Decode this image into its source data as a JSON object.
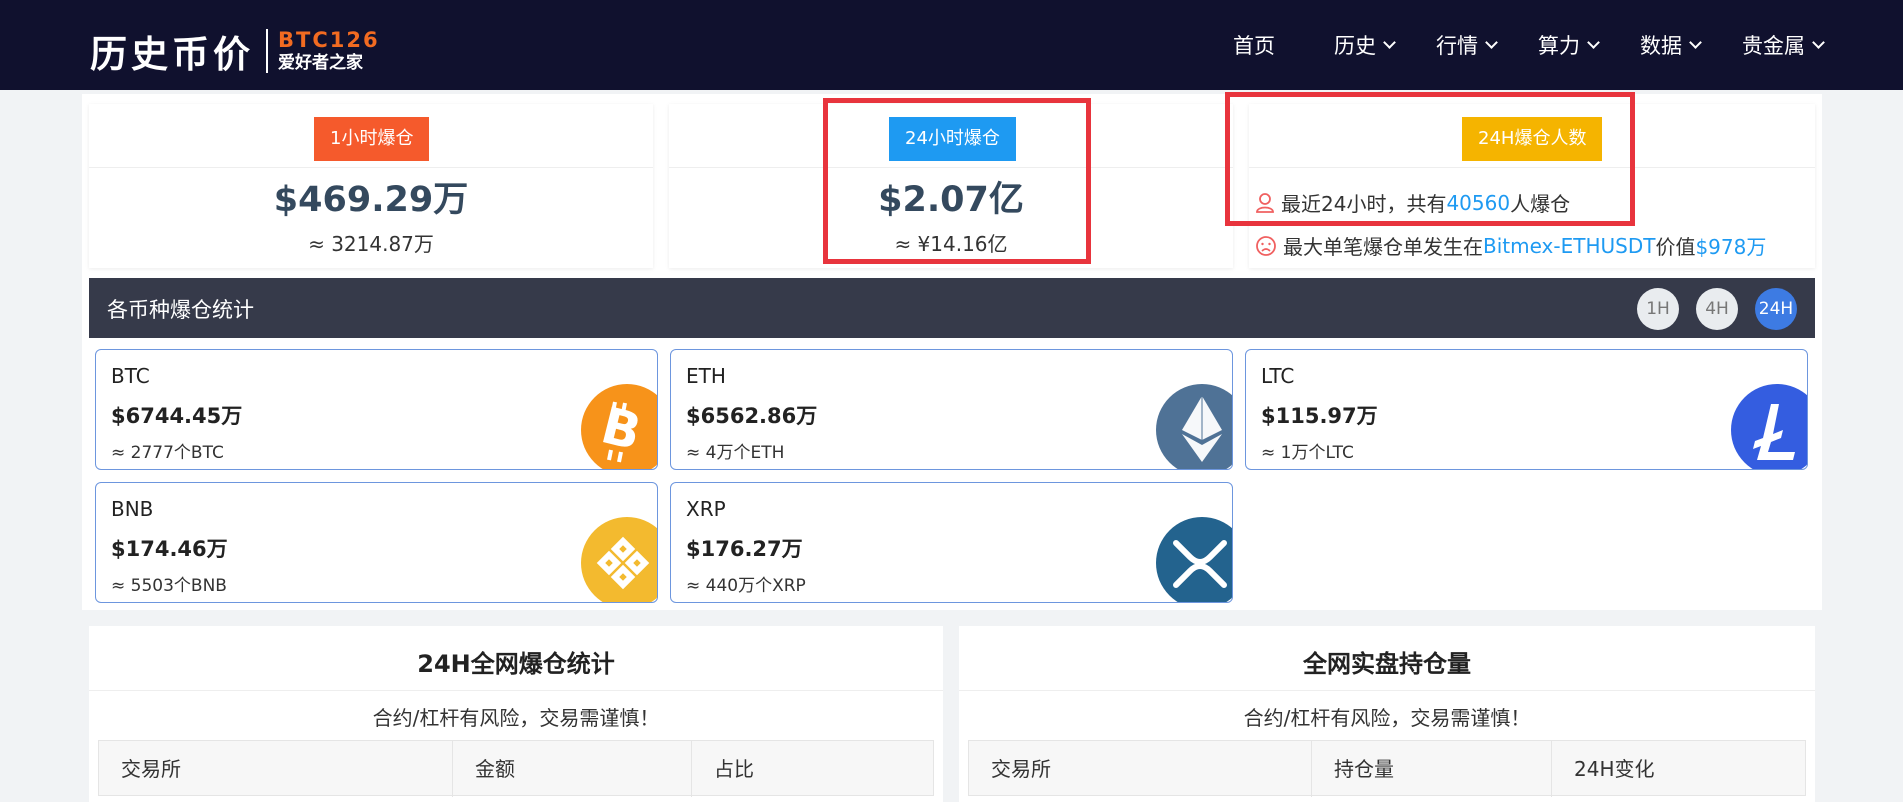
{
  "header": {
    "logo_cn": "历史币价",
    "logo_en": "BTC126",
    "logo_sub": "爱好者之家",
    "nav": [
      {
        "label": "首页",
        "dropdown": false
      },
      {
        "label": "历史",
        "dropdown": true
      },
      {
        "label": "行情",
        "dropdown": true
      },
      {
        "label": "算力",
        "dropdown": true
      },
      {
        "label": "数据",
        "dropdown": true
      },
      {
        "label": "贵金属",
        "dropdown": true
      }
    ]
  },
  "summary": {
    "h1": {
      "badge": "1小时爆仓",
      "usd": "$469.29万",
      "approx": "≈ 3214.87万",
      "color": "#f55a2c"
    },
    "h24": {
      "badge": "24小时爆仓",
      "usd": "$2.07亿",
      "approx": "≈ ¥14.16亿",
      "color": "#1e9af2"
    },
    "people": {
      "badge": "24H爆仓人数",
      "color": "#f5b400",
      "line1_prefix": "最近24小时，共有",
      "line1_count": "40560",
      "line1_suffix": "人爆仓",
      "line2_prefix": "最大单笔爆仓单发生在",
      "line2_exchange": "Bitmex-ETHUSDT",
      "line2_mid": "价值",
      "line2_value": "$978万"
    }
  },
  "coin_stats": {
    "title": "各币种爆仓统计",
    "time_buttons": [
      {
        "label": "1H",
        "active": false
      },
      {
        "label": "4H",
        "active": false
      },
      {
        "label": "24H",
        "active": true
      }
    ],
    "coins": [
      {
        "name": "BTC",
        "value": "$6744.45万",
        "qty": "≈ 2777个BTC",
        "color": "#f7931a",
        "icon": "bitcoin-icon"
      },
      {
        "name": "ETH",
        "value": "$6562.86万",
        "qty": "≈ 4万个ETH",
        "color": "#4f7296",
        "icon": "ethereum-icon"
      },
      {
        "name": "LTC",
        "value": "$115.97万",
        "qty": "≈ 1万个LTC",
        "color": "#345de0",
        "icon": "litecoin-icon"
      },
      {
        "name": "BNB",
        "value": "$174.46万",
        "qty": "≈ 5503个BNB",
        "color": "#f3ba2f",
        "icon": "bnb-icon"
      },
      {
        "name": "XRP",
        "value": "$176.27万",
        "qty": "≈ 440万个XRP",
        "color": "#23638e",
        "icon": "xrp-icon"
      }
    ]
  },
  "panels": {
    "left": {
      "title": "24H全网爆仓统计",
      "note": "合约/杠杆有风险，交易需谨慎！",
      "columns": [
        "交易所",
        "金额",
        "占比"
      ]
    },
    "right": {
      "title": "全网实盘持仓量",
      "note": "合约/杠杆有风险，交易需谨慎！",
      "columns": [
        "交易所",
        "持仓量",
        "24H变化"
      ]
    }
  }
}
